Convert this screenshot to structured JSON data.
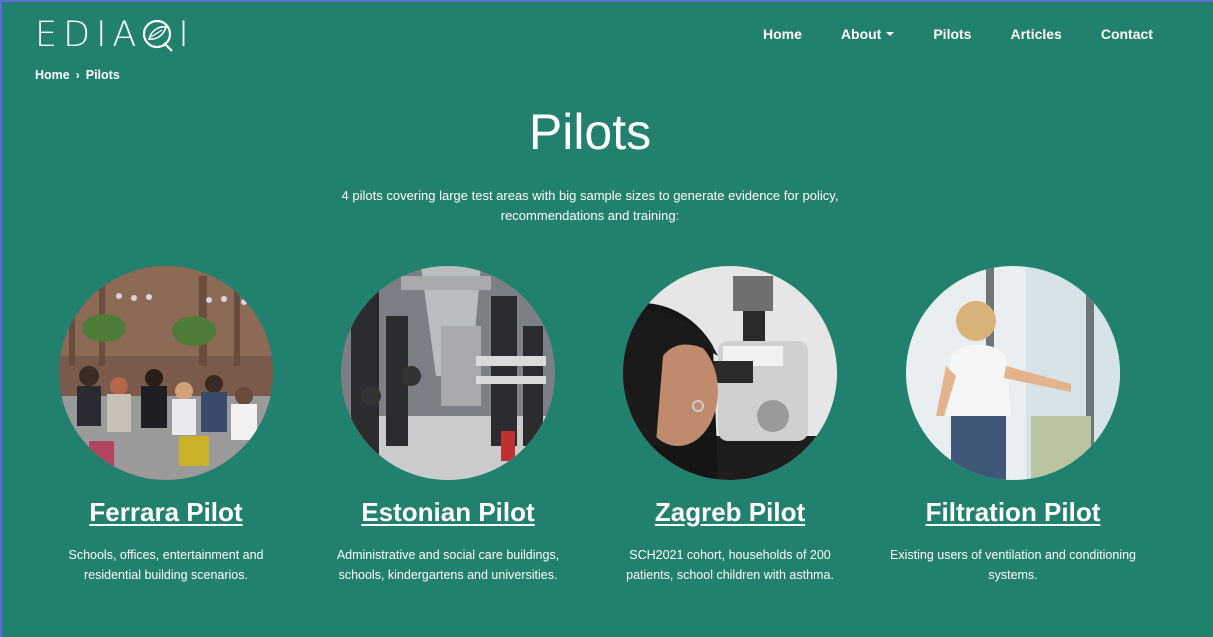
{
  "brand": {
    "name_left": "EDIA",
    "name_right": "I"
  },
  "nav": {
    "items": [
      {
        "label": "Home",
        "has_dropdown": false
      },
      {
        "label": "About",
        "has_dropdown": true
      },
      {
        "label": "Pilots",
        "has_dropdown": false
      },
      {
        "label": "Articles",
        "has_dropdown": false
      },
      {
        "label": "Contact",
        "has_dropdown": false
      }
    ]
  },
  "breadcrumb": {
    "home": "Home",
    "separator": "›",
    "current": "Pilots"
  },
  "page": {
    "title": "Pilots",
    "intro": "4 pilots covering large test areas with big sample sizes to generate evidence for policy, recommendations and training:"
  },
  "pilots": [
    {
      "title": "Ferrara Pilot",
      "description": "Schools, offices, entertainment and residential building scenarios.",
      "image": "people-workshop-photo"
    },
    {
      "title": "Estonian Pilot",
      "description": "Administrative and social care buildings, schools, kindergartens and universities.",
      "image": "ventilation-plant-room-photo"
    },
    {
      "title": "Zagreb Pilot",
      "description": "SCH2021 cohort, households of 200 patients, school children with asthma.",
      "image": "microscope-photo"
    },
    {
      "title": "Filtration Pilot",
      "description": "Existing users of ventilation and conditioning systems.",
      "image": "person-at-window-photo"
    }
  ],
  "colors": {
    "background": "#22806f",
    "text": "#ffffff"
  }
}
